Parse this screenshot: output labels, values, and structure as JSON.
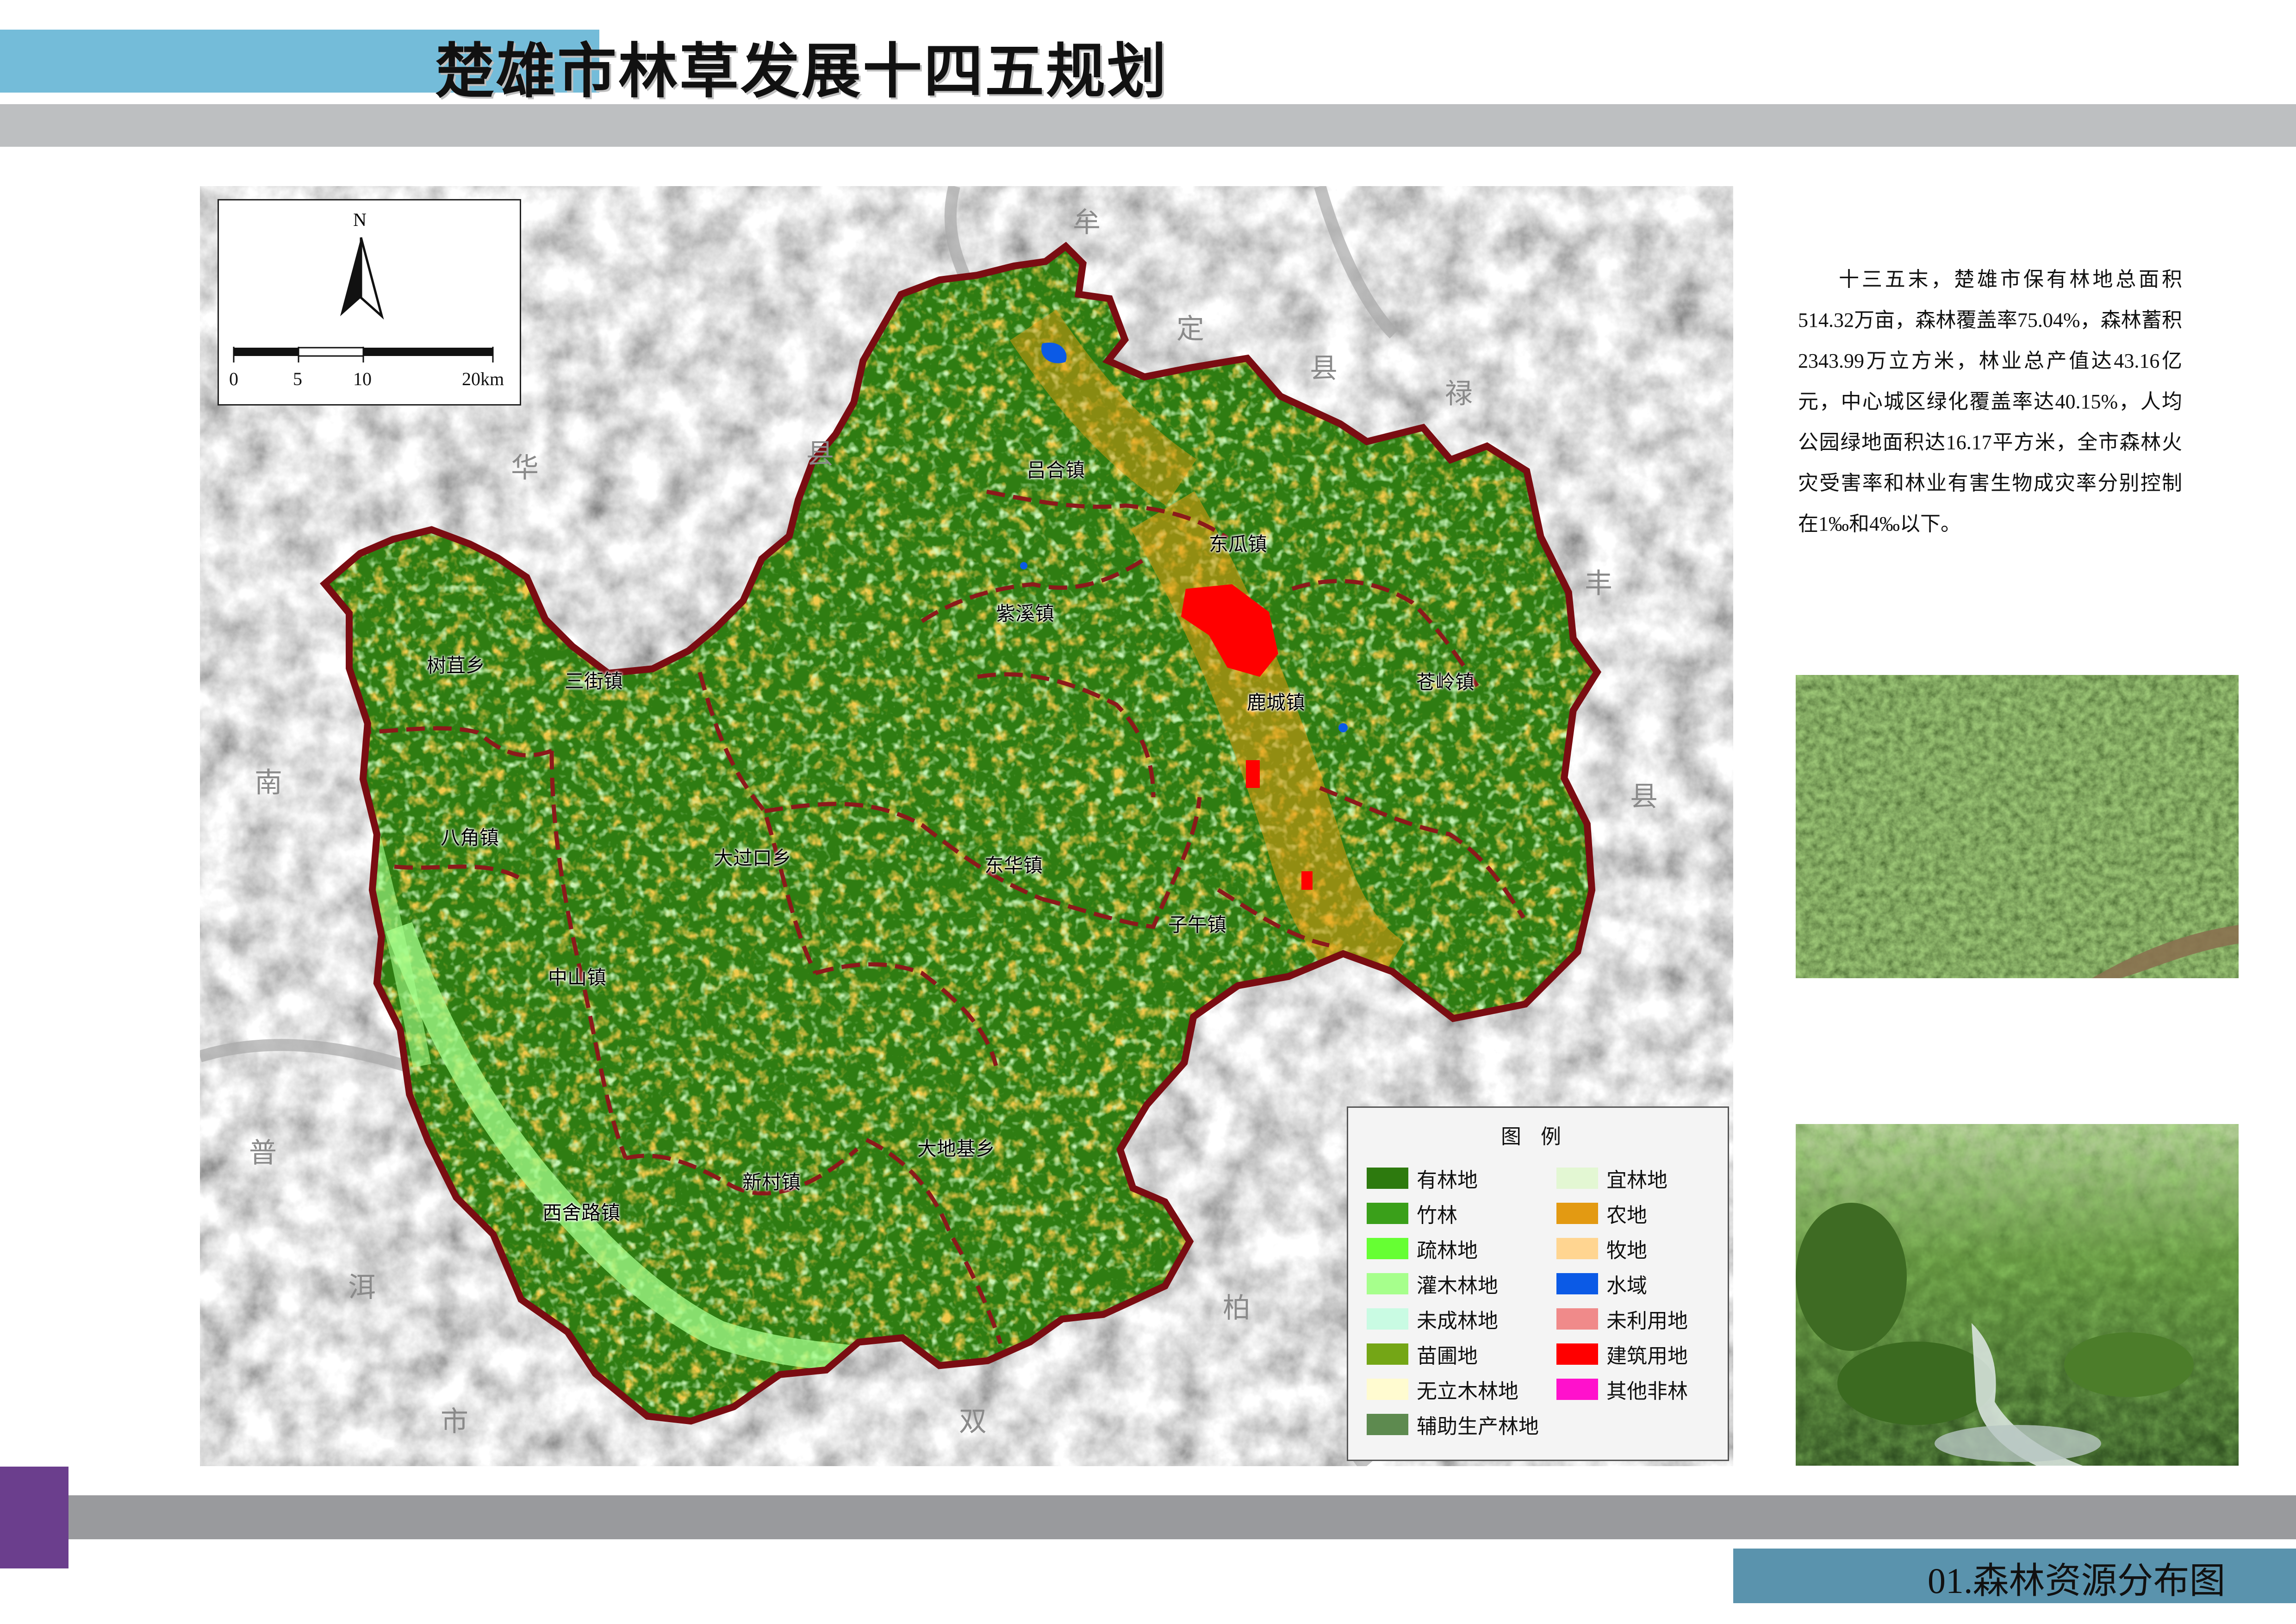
{
  "header": {
    "title": "楚雄市林草发展十四五规划"
  },
  "footer": {
    "caption": "01.森林资源分布图"
  },
  "map": {
    "north_letter": "N",
    "scale_labels": [
      "0",
      "5",
      "10",
      "20km"
    ],
    "neighbors": [
      "牟",
      "定",
      "县",
      "禄",
      "丰",
      "县",
      "华",
      "县",
      "南",
      "县",
      "普",
      "洱",
      "市",
      "柏",
      "双"
    ],
    "towns": [
      "吕合镇",
      "东瓜镇",
      "紫溪镇",
      "鹿城镇",
      "苍岭镇",
      "树苴乡",
      "三街镇",
      "八角镇",
      "大过口乡",
      "东华镇",
      "子午镇",
      "中山镇",
      "新村镇",
      "大地基乡",
      "西舍路镇"
    ]
  },
  "legend": {
    "title": "图 例",
    "items": [
      {
        "label": "有林地",
        "color": "#2d7a0e"
      },
      {
        "label": "宜林地",
        "color": "#e3f7d3"
      },
      {
        "label": "竹林",
        "color": "#3aa01a"
      },
      {
        "label": "农地",
        "color": "#e39a12"
      },
      {
        "label": "疏林地",
        "color": "#66ff33"
      },
      {
        "label": "牧地",
        "color": "#ffd591"
      },
      {
        "label": "灌木林地",
        "color": "#a6ff8c"
      },
      {
        "label": "水域",
        "color": "#0b5ae6"
      },
      {
        "label": "未成林地",
        "color": "#c9fbe3"
      },
      {
        "label": "未利用地",
        "color": "#f08a8a"
      },
      {
        "label": "苗圃地",
        "color": "#74a616"
      },
      {
        "label": "建筑用地",
        "color": "#ff0000"
      },
      {
        "label": "无立木林地",
        "color": "#fffbd0"
      },
      {
        "label": "其他非林",
        "color": "#ff11cc"
      },
      {
        "label": "辅助生产林地",
        "color": "#5d8a4f"
      }
    ]
  },
  "side": {
    "text": "十三五末，楚雄市保有林地总面积514.32万亩，森林覆盖率75.04%，森林蓄积2343.99万立方米，林业总产值达43.16亿元，中心城区绿化覆盖率达40.15%，人均公园绿地面积达16.17平方米，全市森林火灾受害率和林业有害生物成灾率分别控制在1‰和4‰以下。"
  }
}
